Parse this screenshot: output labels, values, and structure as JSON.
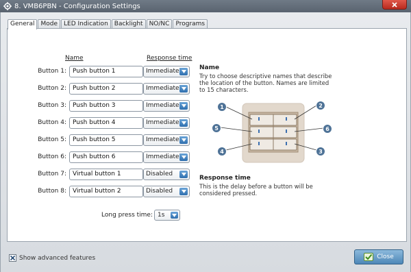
{
  "window": {
    "title": "8. VMB6PBN - Configuration Settings",
    "icon": "gear-icon",
    "close_icon": "close-x-icon"
  },
  "tabs": [
    {
      "label": "General",
      "active": true
    },
    {
      "label": "Mode",
      "active": false
    },
    {
      "label": "LED Indication",
      "active": false
    },
    {
      "label": "Backlight",
      "active": false
    },
    {
      "label": "NO/NC",
      "active": false
    },
    {
      "label": "Programs",
      "active": false
    }
  ],
  "general": {
    "col_name": "Name",
    "col_response": "Response time",
    "rows": [
      {
        "label": "Button 1:",
        "name": "Push button 1",
        "response": "Immediately"
      },
      {
        "label": "Button 2:",
        "name": "Push button 2",
        "response": "Immediately"
      },
      {
        "label": "Button 3:",
        "name": "Push button 3",
        "response": "Immediately"
      },
      {
        "label": "Button 4:",
        "name": "Push button 4",
        "response": "Immediately"
      },
      {
        "label": "Button 5:",
        "name": "Push button 5",
        "response": "Immediately"
      },
      {
        "label": "Button 6:",
        "name": "Push button 6",
        "response": "Immediately"
      },
      {
        "label": "Button 7:",
        "name": "Virtual button 1",
        "response": "Disabled"
      },
      {
        "label": "Button 8:",
        "name": "Virtual button 2",
        "response": "Disabled"
      }
    ],
    "long_press_label": "Long press time:",
    "long_press_value": "1s"
  },
  "help": {
    "name_title": "Name",
    "name_text": "Try to choose descriptive names that describe the location of the button. Names are limited to 15 characters.",
    "response_title": "Response time",
    "response_text": "This is the delay before a button will be considered pressed.",
    "diagram_markers": [
      "1",
      "2",
      "3",
      "4",
      "5",
      "6"
    ]
  },
  "footer": {
    "advanced_label": "Show advanced features",
    "advanced_checked": true,
    "close_label": "Close"
  },
  "colors": {
    "accent": "#4d87b7",
    "marker": "#4f7397",
    "close_red": "#c8382b"
  }
}
